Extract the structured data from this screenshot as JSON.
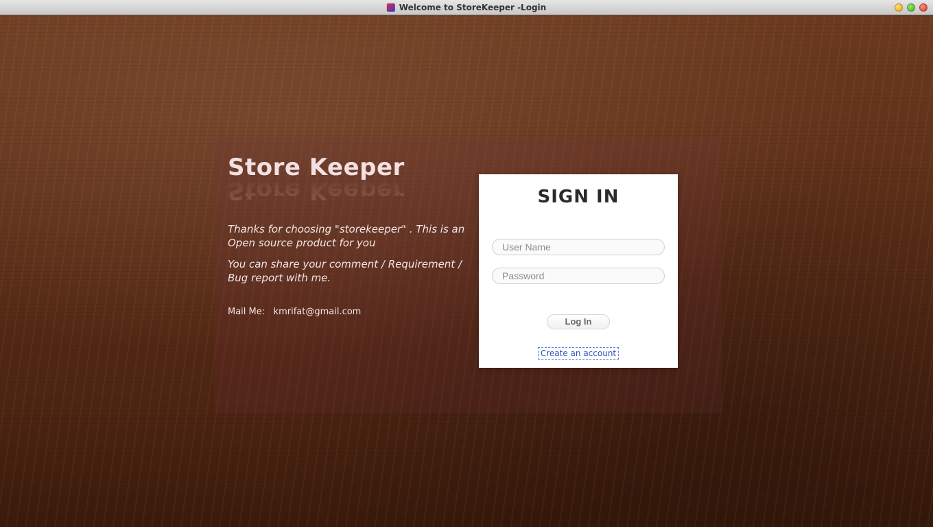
{
  "window": {
    "title": "Welcome to StoreKeeper -Login"
  },
  "info": {
    "brand": "Store Keeper",
    "thanks": "Thanks for choosing \"storekeeper\" . This is an Open source product for you",
    "share": "You can share your comment / Requirement / Bug report with me.",
    "mail_label": "Mail Me:",
    "mail_value": "kmrifat@gmail.com"
  },
  "signin": {
    "heading": "SIGN IN",
    "username_placeholder": "User Name",
    "password_placeholder": "Password",
    "login_label": "Log In",
    "create_label": "Create an account"
  }
}
